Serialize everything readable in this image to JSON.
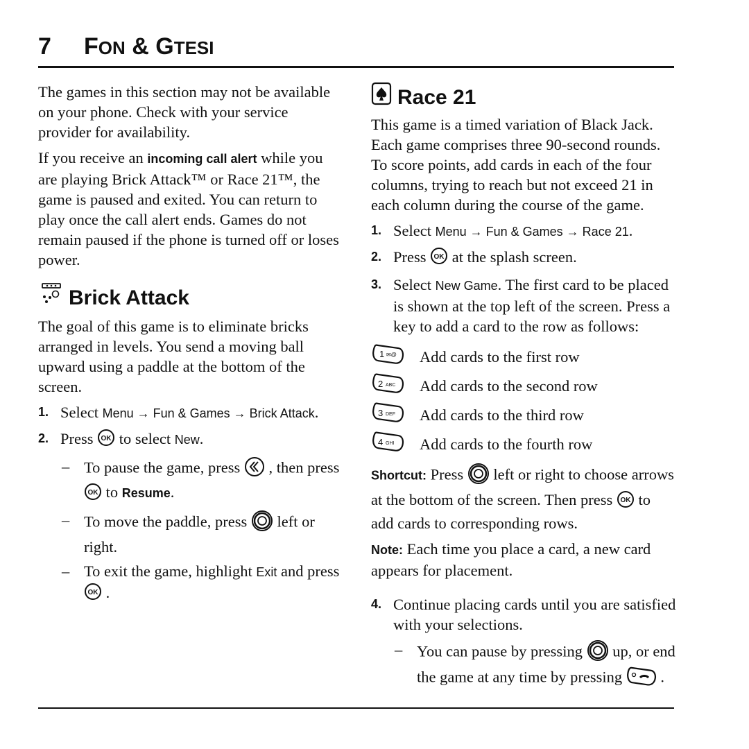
{
  "chapter": {
    "number": "7",
    "title_first": "F",
    "title_first_rest": "ON",
    "amp": " & ",
    "title_second": "G",
    "title_second_rest": "TESI"
  },
  "intro": {
    "p1": "The games in this section may not be available on your phone. Check with your service provider for availability.",
    "p2_a": "If you receive an ",
    "p2_bold": "incoming call alert",
    "p2_b": " while you are playing Brick Attack™ or Race 21™, the game is paused and exited. You can return to play once the call alert ends. Games do not remain paused if the phone is turned off or loses power."
  },
  "brick": {
    "title": "Brick Attack",
    "desc": "The goal of this game is to eliminate bricks arranged in levels. You send a moving ball upward using a paddle at the bottom of the screen.",
    "step1": {
      "n": "1.",
      "pre": "Select ",
      "path": "Menu → Fun & Games → Brick Attack",
      "post": "."
    },
    "step2": {
      "n": "2.",
      "pre": "Press ",
      "mid": " to select ",
      "bold": "New",
      "post": "."
    },
    "sub1": {
      "pre": "To pause the game, press ",
      "mid": " , then press ",
      "mid2": " to ",
      "bold": "Resume",
      "post": "."
    },
    "sub2": {
      "pre": "To move the paddle, press ",
      "post": " left or right."
    },
    "sub3": {
      "pre": "To exit the game, highlight ",
      "bold": "Exit",
      "mid": " and press ",
      "post": " ."
    }
  },
  "race": {
    "title": "Race 21",
    "desc": "This game is a timed variation of Black Jack. Each game comprises three 90-second rounds. To score points, add cards in each of the four columns, trying to reach but not exceed 21 in each column during the course of the game.",
    "step1": {
      "n": "1.",
      "pre": "Select ",
      "path": "Menu → Fun & Games → Race 21",
      "post": "."
    },
    "step2": {
      "n": "2.",
      "pre": "Press ",
      "post": " at the splash screen."
    },
    "step3": {
      "n": "3.",
      "pre": "Select ",
      "bold": "New Game",
      "post": ". The first card to be placed is shown at the top left of the screen. Press a key to add a card to the row as follows:"
    },
    "keys": [
      {
        "key": "1",
        "sub": "✉@",
        "label": "Add cards to the first row"
      },
      {
        "key": "2",
        "sub": "ABC",
        "label": "Add cards to the second row"
      },
      {
        "key": "3",
        "sub": "DEF",
        "label": "Add cards to the third row"
      },
      {
        "key": "4",
        "sub": "GHI",
        "label": "Add cards to the fourth row"
      }
    ],
    "shortcut": {
      "label": "Shortcut:",
      "pre": " Press ",
      "mid": " left or right to choose arrows at the bottom of the screen. Then press ",
      "post": " to add cards to corresponding rows."
    },
    "note": {
      "label": "Note:",
      "text": " Each time you place a card, a new card appears for placement."
    },
    "step4": {
      "n": "4.",
      "text": "Continue placing cards until you are satisfied with your selections."
    },
    "sub1": {
      "pre": "You can pause by pressing ",
      "mid": " up, or end the game at any time by pressing ",
      "post": " ."
    }
  },
  "icons": {
    "ok": "OK"
  }
}
